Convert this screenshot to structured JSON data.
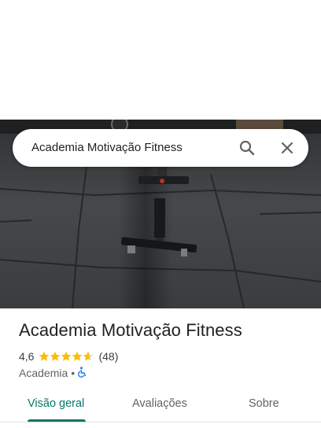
{
  "search": {
    "query": "Academia Motivação Fitness",
    "search_icon": "search-icon",
    "close_icon": "close-icon"
  },
  "place": {
    "name": "Academia Motivação Fitness",
    "rating_text": "4,6",
    "rating_value": 4.6,
    "review_count_text": "(48)",
    "category": "Academia",
    "separator": "•",
    "accessibility_icon": "wheelchair-icon"
  },
  "tabs": [
    {
      "label": "Visão geral",
      "active": true
    },
    {
      "label": "Avaliações",
      "active": false
    },
    {
      "label": "Sobre",
      "active": false
    }
  ],
  "colors": {
    "accent": "#00796b",
    "star": "#fbbc04",
    "accessibility": "#1a73e8"
  }
}
